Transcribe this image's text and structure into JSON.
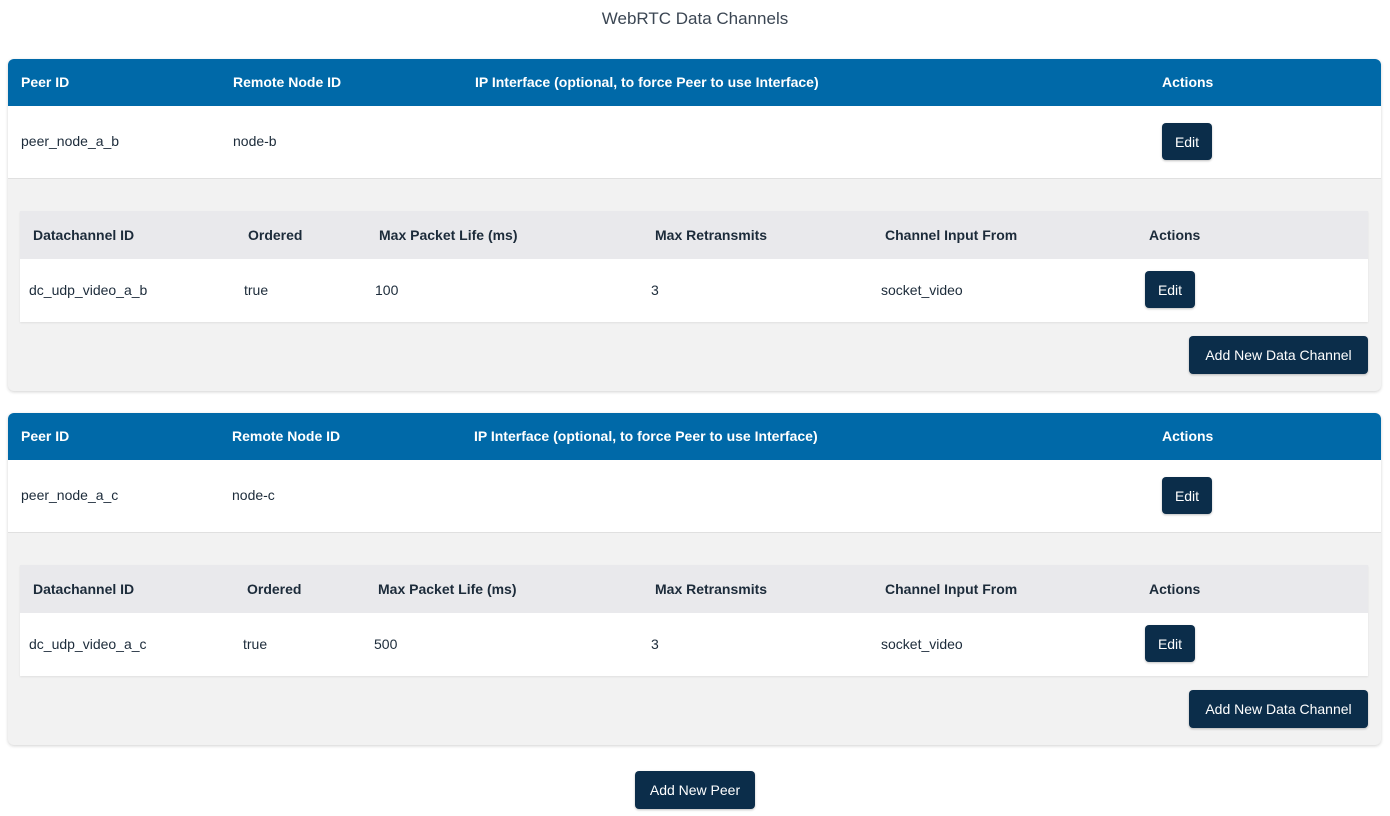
{
  "page": {
    "title": "WebRTC Data Channels"
  },
  "peer_columns": {
    "peer_id": "Peer ID",
    "remote_node_id": "Remote Node ID",
    "ip_interface": "IP Interface (optional, to force Peer to use Interface)",
    "actions": "Actions"
  },
  "dc_columns": {
    "datachannel_id": "Datachannel ID",
    "ordered": "Ordered",
    "max_packet_life": "Max Packet Life (ms)",
    "max_retransmits": "Max Retransmits",
    "channel_input_from": "Channel Input From",
    "actions": "Actions"
  },
  "peers": [
    {
      "peer_id": "peer_node_a_b",
      "remote_node_id": "node-b",
      "ip_interface": "",
      "edit_label": "Edit",
      "channels": [
        {
          "datachannel_id": "dc_udp_video_a_b",
          "ordered": "true",
          "max_packet_life": "100",
          "max_retransmits": "3",
          "channel_input_from": "socket_video",
          "edit_label": "Edit"
        }
      ],
      "add_channel_label": "Add New Data Channel"
    },
    {
      "peer_id": "peer_node_a_c",
      "remote_node_id": "node-c",
      "ip_interface": "",
      "edit_label": "Edit",
      "channels": [
        {
          "datachannel_id": "dc_udp_video_a_c",
          "ordered": "true",
          "max_packet_life": "500",
          "max_retransmits": "3",
          "channel_input_from": "socket_video",
          "edit_label": "Edit"
        }
      ],
      "add_channel_label": "Add New Data Channel"
    }
  ],
  "footer": {
    "add_peer_label": "Add New Peer"
  },
  "colors": {
    "peer_header_bg": "#0069a8",
    "button_bg": "#0b2d4a",
    "card_bg": "#f2f2f2",
    "dc_header_bg": "#e9e9ec"
  }
}
